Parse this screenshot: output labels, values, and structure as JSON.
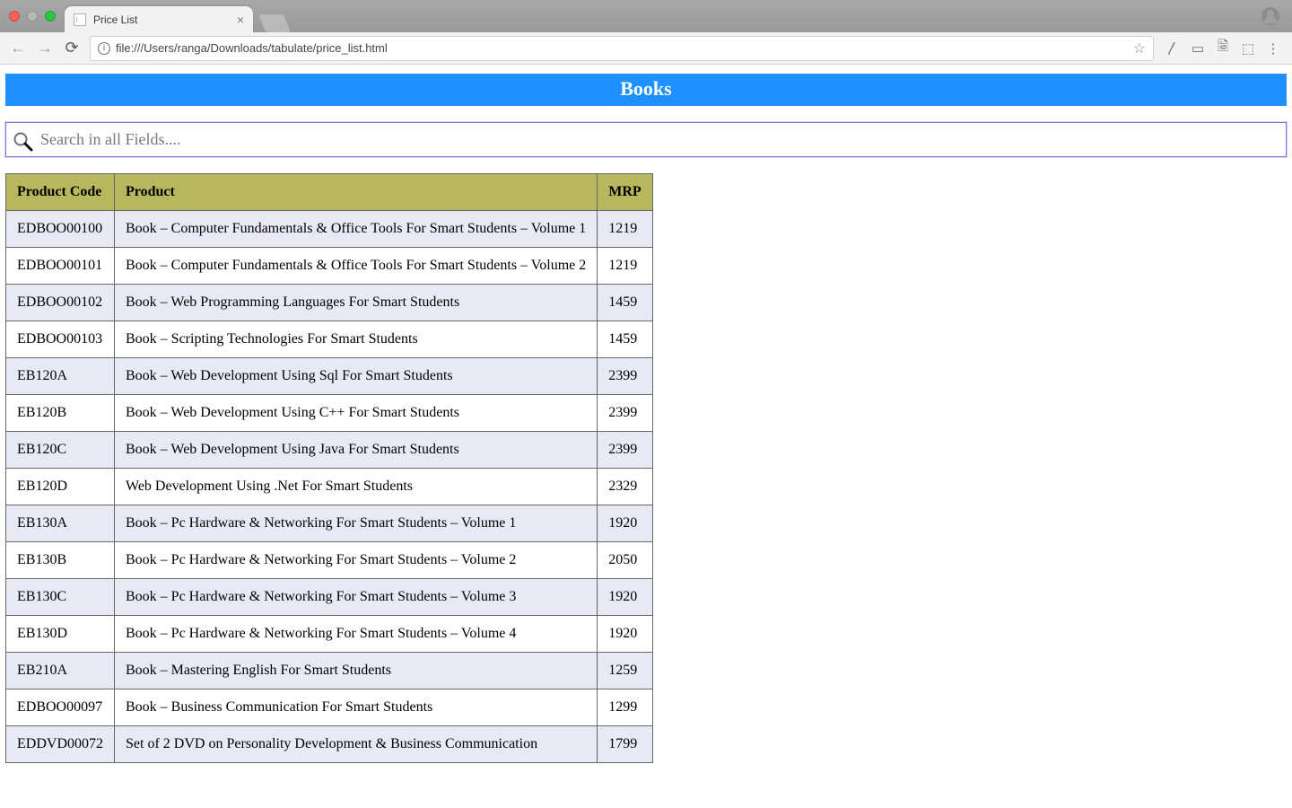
{
  "browser": {
    "tab_title": "Price List",
    "url_display": "file:///Users/ranga/Downloads/tabulate/price_list.html"
  },
  "page": {
    "heading": "Books",
    "search_placeholder": "Search in all Fields....",
    "columns": [
      "Product Code",
      "Product",
      "MRP"
    ],
    "rows": [
      {
        "code": "EDBOO00100",
        "product": "Book – Computer Fundamentals & Office Tools For Smart Students – Volume 1",
        "mrp": "1219"
      },
      {
        "code": "EDBOO00101",
        "product": "Book – Computer Fundamentals & Office Tools For Smart Students – Volume 2",
        "mrp": "1219"
      },
      {
        "code": "EDBOO00102",
        "product": "Book – Web Programming Languages For Smart Students",
        "mrp": "1459"
      },
      {
        "code": "EDBOO00103",
        "product": "Book – Scripting Technologies For Smart Students",
        "mrp": "1459"
      },
      {
        "code": "EB120A",
        "product": "Book – Web Development Using Sql For Smart Students",
        "mrp": "2399"
      },
      {
        "code": "EB120B",
        "product": "Book – Web Development Using C++ For Smart Students",
        "mrp": "2399"
      },
      {
        "code": "EB120C",
        "product": "Book – Web Development Using Java For Smart Students",
        "mrp": "2399"
      },
      {
        "code": "EB120D",
        "product": "Web Development Using .Net For Smart Students",
        "mrp": "2329"
      },
      {
        "code": "EB130A",
        "product": "Book – Pc Hardware & Networking For Smart Students – Volume 1",
        "mrp": "1920"
      },
      {
        "code": "EB130B",
        "product": "Book – Pc Hardware & Networking For Smart Students – Volume 2",
        "mrp": "2050"
      },
      {
        "code": "EB130C",
        "product": "Book – Pc Hardware & Networking For Smart Students – Volume 3",
        "mrp": "1920"
      },
      {
        "code": "EB130D",
        "product": "Book – Pc Hardware & Networking For Smart Students – Volume 4",
        "mrp": "1920"
      },
      {
        "code": "EB210A",
        "product": "Book – Mastering English For Smart Students",
        "mrp": "1259"
      },
      {
        "code": "EDBOO00097",
        "product": "Book – Business Communication For Smart Students",
        "mrp": "1299"
      },
      {
        "code": "EDDVD00072",
        "product": "Set of 2 DVD on Personality Development & Business Communication",
        "mrp": "1799"
      }
    ]
  }
}
